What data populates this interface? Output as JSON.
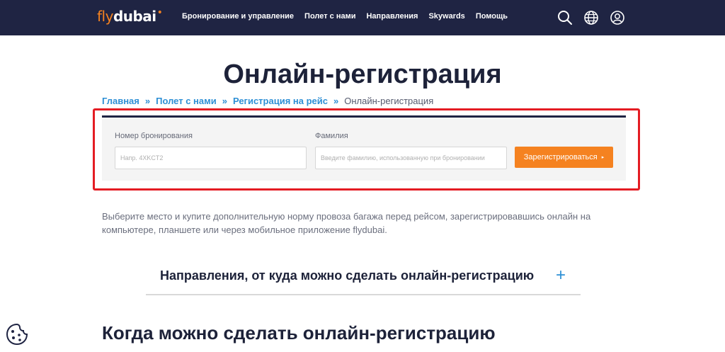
{
  "header": {
    "logo_fly": "fly",
    "logo_dubai": "dubai",
    "nav": [
      "Бронирование и управление",
      "Полет с нами",
      "Направления",
      "Skywards",
      "Помощь"
    ],
    "icons": [
      "search-icon",
      "globe-icon",
      "user-icon"
    ]
  },
  "page": {
    "title": "Онлайн-регистрация"
  },
  "breadcrumb": {
    "items": [
      "Главная",
      "Полет с нами",
      "Регистрация на рейс"
    ],
    "separator": "»",
    "current": "Онлайн-регистрация"
  },
  "form": {
    "booking_label": "Номер бронирования",
    "booking_placeholder": "Напр. 4XKCT2",
    "booking_value": "",
    "surname_label": "Фамилия",
    "surname_placeholder": "Введите фамилию, использованную при бронировании",
    "surname_value": "",
    "submit_label": "Зарегистрироваться",
    "submit_caret": "▸"
  },
  "content": {
    "intro": "Выберите место и купите дополнительную норму провоза багажа перед рейсом, зарегистрировавшись онлайн на компьютере, планшете или через мобильное приложение flydubai.",
    "accordion_title": "Направления, от куда можно сделать онлайн-регистрацию",
    "accordion_icon": "+",
    "section_title": "Когда можно сделать онлайн-регистрацию"
  },
  "colors": {
    "header_bg": "#1f2443",
    "accent_orange": "#f58220",
    "link_blue": "#2d8fd5",
    "highlight_red": "#e41c23"
  }
}
